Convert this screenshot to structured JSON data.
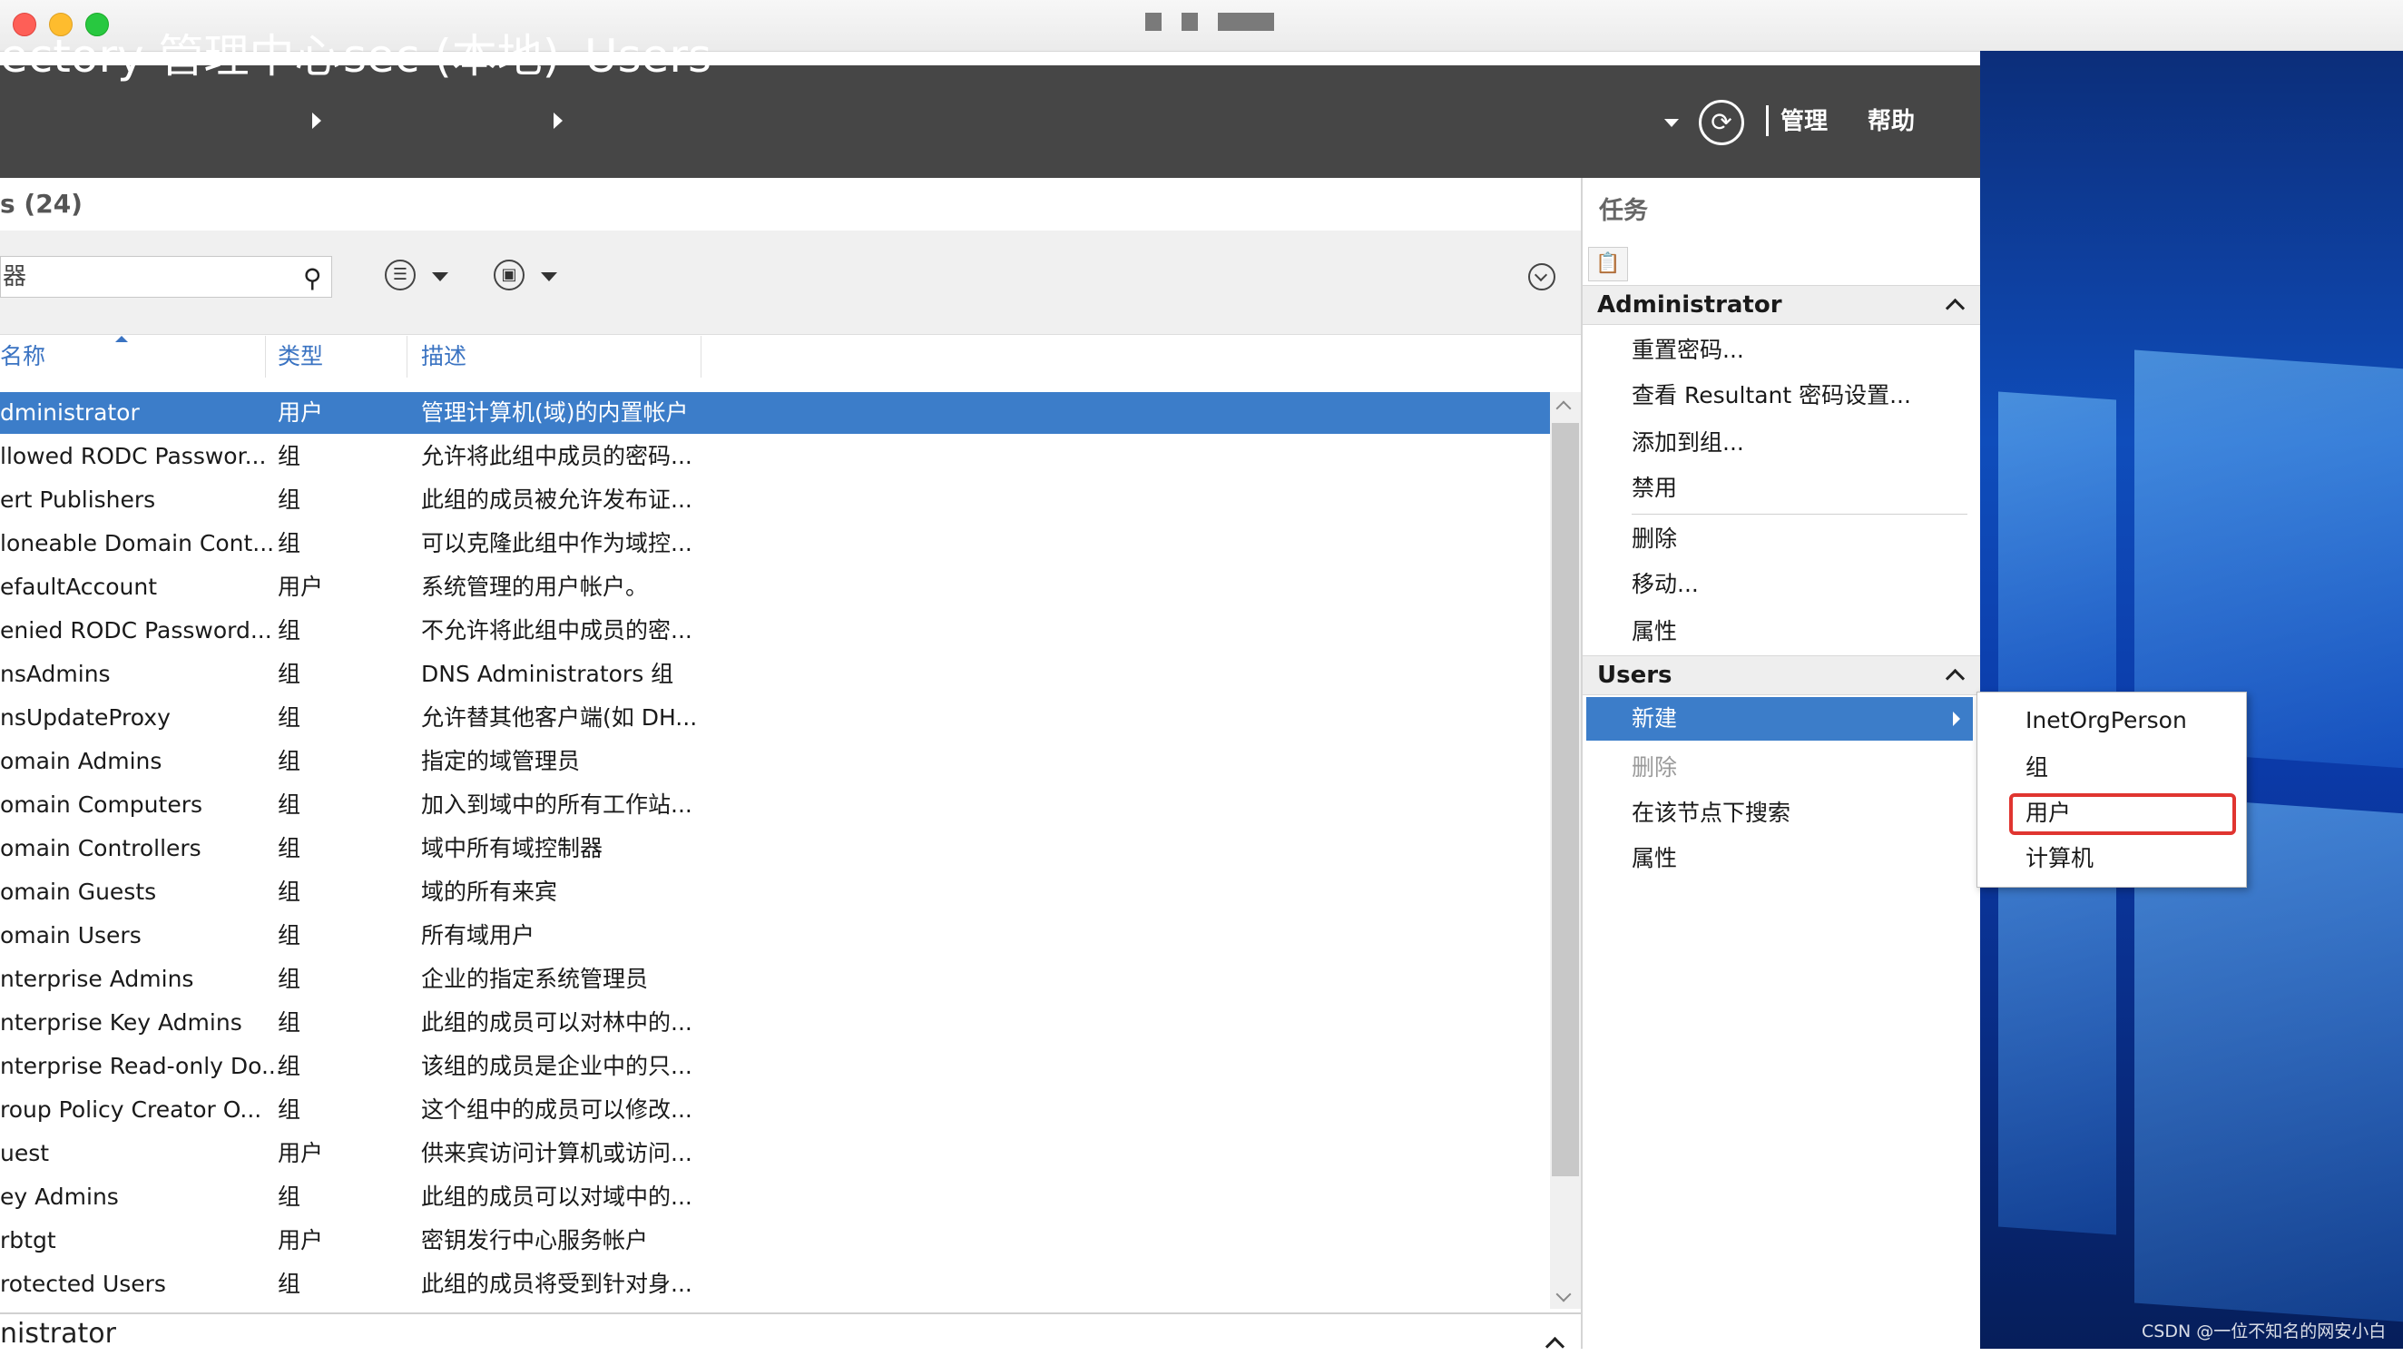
{
  "window": {
    "title_blocks": [
      "",
      "",
      ""
    ]
  },
  "header": {
    "breadcrumb": [
      "ectory 管理中心",
      "sec (本地)",
      "Users"
    ],
    "links": [
      "管理",
      "帮助"
    ]
  },
  "list": {
    "count": "s (24)",
    "filter_text": "器",
    "columns": [
      "名称",
      "类型",
      "描述"
    ],
    "rows": [
      {
        "name": "dministrator",
        "type": "用户",
        "desc": "管理计算机(域)的内置帐户"
      },
      {
        "name": "llowed RODC Passwor...",
        "type": "组",
        "desc": "允许将此组中成员的密码..."
      },
      {
        "name": "ert Publishers",
        "type": "组",
        "desc": "此组的成员被允许发布证..."
      },
      {
        "name": "loneable Domain Cont...",
        "type": "组",
        "desc": "可以克隆此组中作为域控..."
      },
      {
        "name": "efaultAccount",
        "type": "用户",
        "desc": "系统管理的用户帐户。"
      },
      {
        "name": "enied RODC Password...",
        "type": "组",
        "desc": "不允许将此组中成员的密..."
      },
      {
        "name": "nsAdmins",
        "type": "组",
        "desc": "DNS Administrators 组"
      },
      {
        "name": "nsUpdateProxy",
        "type": "组",
        "desc": "允许替其他客户端(如 DH..."
      },
      {
        "name": "omain Admins",
        "type": "组",
        "desc": "指定的域管理员"
      },
      {
        "name": "omain Computers",
        "type": "组",
        "desc": "加入到域中的所有工作站..."
      },
      {
        "name": "omain Controllers",
        "type": "组",
        "desc": "域中所有域控制器"
      },
      {
        "name": "omain Guests",
        "type": "组",
        "desc": "域的所有来宾"
      },
      {
        "name": "omain Users",
        "type": "组",
        "desc": "所有域用户"
      },
      {
        "name": "nterprise Admins",
        "type": "组",
        "desc": "企业的指定系统管理员"
      },
      {
        "name": "nterprise Key Admins",
        "type": "组",
        "desc": "此组的成员可以对林中的..."
      },
      {
        "name": "nterprise Read-only Do...",
        "type": "组",
        "desc": "该组的成员是企业中的只..."
      },
      {
        "name": "roup Policy Creator O...",
        "type": "组",
        "desc": "这个组中的成员可以修改..."
      },
      {
        "name": "uest",
        "type": "用户",
        "desc": "供来宾访问计算机或访问..."
      },
      {
        "name": "ey Admins",
        "type": "组",
        "desc": "此组的成员可以对域中的..."
      },
      {
        "name": "rbtgt",
        "type": "用户",
        "desc": "密钥发行中心服务帐户"
      },
      {
        "name": "rotected Users",
        "type": "组",
        "desc": "此组的成员将受到针对身..."
      }
    ],
    "bottom_label": "nistrator"
  },
  "tasks": {
    "title": "任务",
    "section1": {
      "title": "Administrator",
      "items": [
        "重置密码...",
        "查看 Resultant 密码设置...",
        "添加到组...",
        "禁用",
        "删除",
        "移动...",
        "属性"
      ]
    },
    "section2": {
      "title": "Users",
      "selected": "新建",
      "items": [
        "删除",
        "在该节点下搜索",
        "属性"
      ]
    }
  },
  "submenu": {
    "items": [
      "InetOrgPerson",
      "组",
      "用户",
      "计算机"
    ]
  },
  "watermark": "CSDN @一位不知名的网安小白",
  "colors": {
    "header_bg": "#464646",
    "selection": "#3c7dc9",
    "highlight": "#e03530",
    "link": "#3a73c2"
  },
  "icons": [
    "search-icon",
    "list-view-icon",
    "save-query-icon",
    "expand-icon",
    "refresh-icon",
    "clipboard-icon"
  ]
}
